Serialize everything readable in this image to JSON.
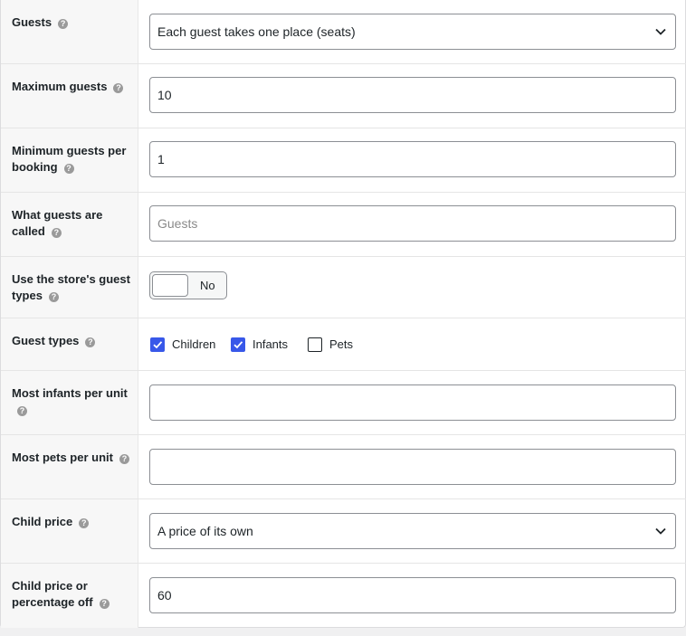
{
  "rows": {
    "guests": {
      "label": "Guests",
      "value": "Each guest takes one place (seats)"
    },
    "max_guests": {
      "label": "Maximum guests",
      "value": "10"
    },
    "min_guests": {
      "label_line1": "Minimum guests per",
      "label_line2": "booking",
      "value": "1"
    },
    "guests_called": {
      "label_line1": "What guests are",
      "label_line2": "called",
      "placeholder": "Guests"
    },
    "store_guest_types": {
      "label_line1": "Use the store's guest",
      "label_line2": "types",
      "toggle_text": "No"
    },
    "guest_types": {
      "label": "Guest types",
      "options": [
        {
          "label": "Children",
          "checked": true
        },
        {
          "label": "Infants",
          "checked": true
        },
        {
          "label": "Pets",
          "checked": false
        }
      ]
    },
    "most_infants": {
      "label": "Most infants per unit",
      "value": ""
    },
    "most_pets": {
      "label": "Most pets per unit",
      "value": ""
    },
    "child_price": {
      "label": "Child price",
      "value": "A price of its own"
    },
    "child_price_pct": {
      "label_line1": "Child price or",
      "label_line2": "percentage off",
      "value": "60"
    }
  },
  "help_glyph": "?",
  "colors": {
    "checkbox_checked": "#3858e9",
    "label_bg": "#f7f7f7",
    "border": "#8c8f94"
  }
}
